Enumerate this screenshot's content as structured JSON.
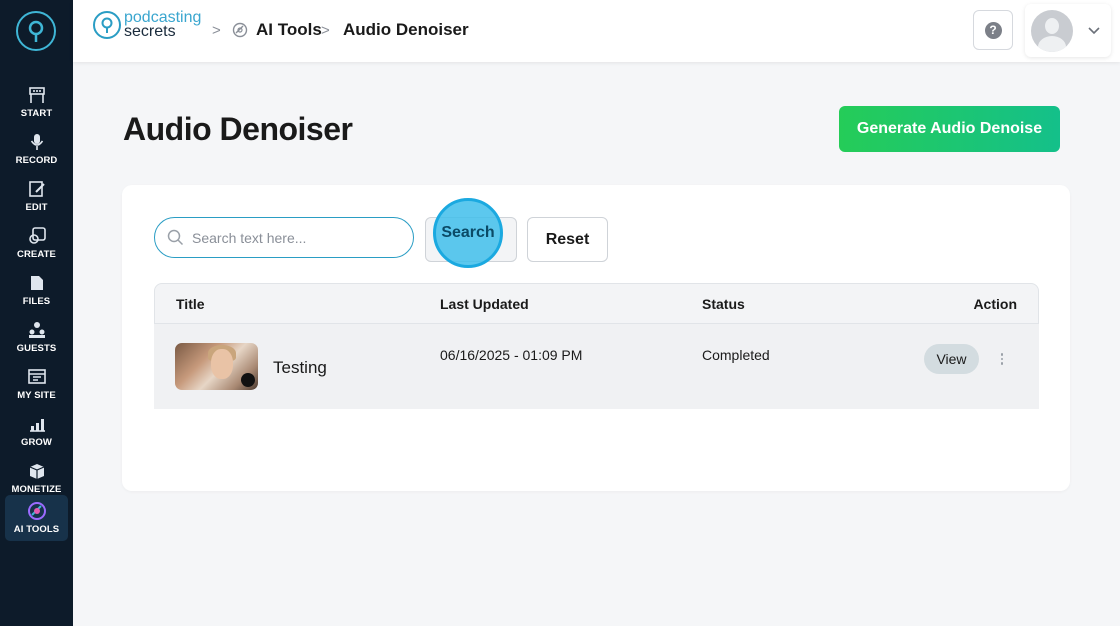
{
  "sidebar": {
    "items": [
      {
        "label": "START",
        "icon": "start-icon"
      },
      {
        "label": "RECORD",
        "icon": "microphone-icon"
      },
      {
        "label": "EDIT",
        "icon": "edit-icon"
      },
      {
        "label": "CREATE",
        "icon": "create-icon"
      },
      {
        "label": "FILES",
        "icon": "files-icon"
      },
      {
        "label": "GUESTS",
        "icon": "guests-icon"
      },
      {
        "label": "MY SITE",
        "icon": "site-icon"
      },
      {
        "label": "GROW",
        "icon": "grow-chart-icon"
      },
      {
        "label": "MONETIZE",
        "icon": "monetize-icon"
      },
      {
        "label": "AI TOOLS",
        "icon": "ai-tools-icon",
        "active": true
      }
    ]
  },
  "header": {
    "brand_line1": "podcasting",
    "brand_line2": "secrets",
    "breadcrumb": [
      "AI Tools",
      "Audio Denoiser"
    ],
    "help_symbol": "?"
  },
  "main": {
    "title": "Audio Denoiser",
    "generate_label": "Generate Audio Denoise",
    "search": {
      "placeholder": "Search text here...",
      "button_label": "Search",
      "reset_label": "Reset"
    },
    "table": {
      "columns": [
        "Title",
        "Last Updated",
        "Status",
        "Action"
      ],
      "rows": [
        {
          "title": "Testing",
          "last_updated": "06/16/2025 - 01:09 PM",
          "status": "Completed",
          "action": "View"
        }
      ]
    }
  },
  "colors": {
    "sidebar_bg": "#0d1b2a",
    "brand_blue": "#2a9dc4",
    "generate_green": "#25cc58",
    "highlight_blue": "#40beeb"
  }
}
